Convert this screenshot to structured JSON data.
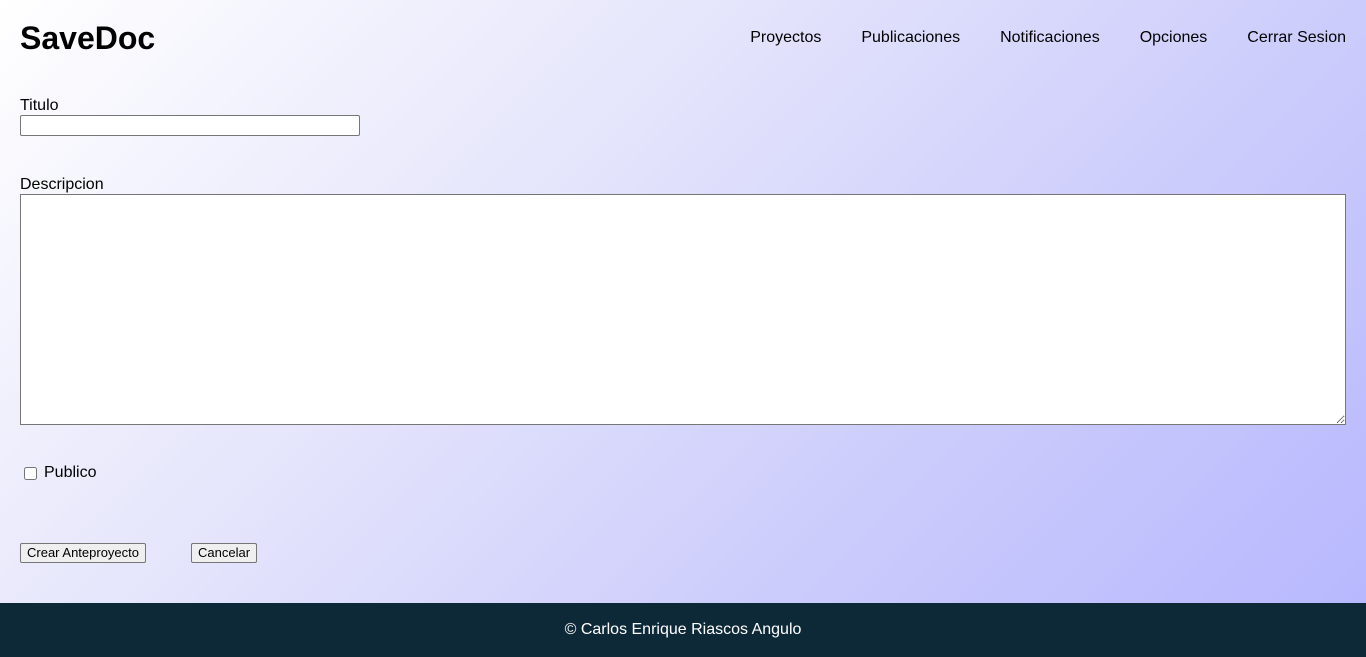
{
  "header": {
    "brand": "SaveDoc",
    "nav": [
      "Proyectos",
      "Publicaciones",
      "Notificaciones",
      "Opciones",
      "Cerrar Sesion"
    ]
  },
  "form": {
    "title_label": "Titulo",
    "title_value": "",
    "description_label": "Descripcion",
    "description_value": "",
    "public_label": "Publico",
    "public_checked": false,
    "submit_label": "Crear Anteproyecto",
    "cancel_label": "Cancelar"
  },
  "footer": {
    "text": "© Carlos Enrique Riascos Angulo"
  },
  "colors": {
    "footer_bg": "#0d2837",
    "gradient_end": "#b6b6ff"
  }
}
